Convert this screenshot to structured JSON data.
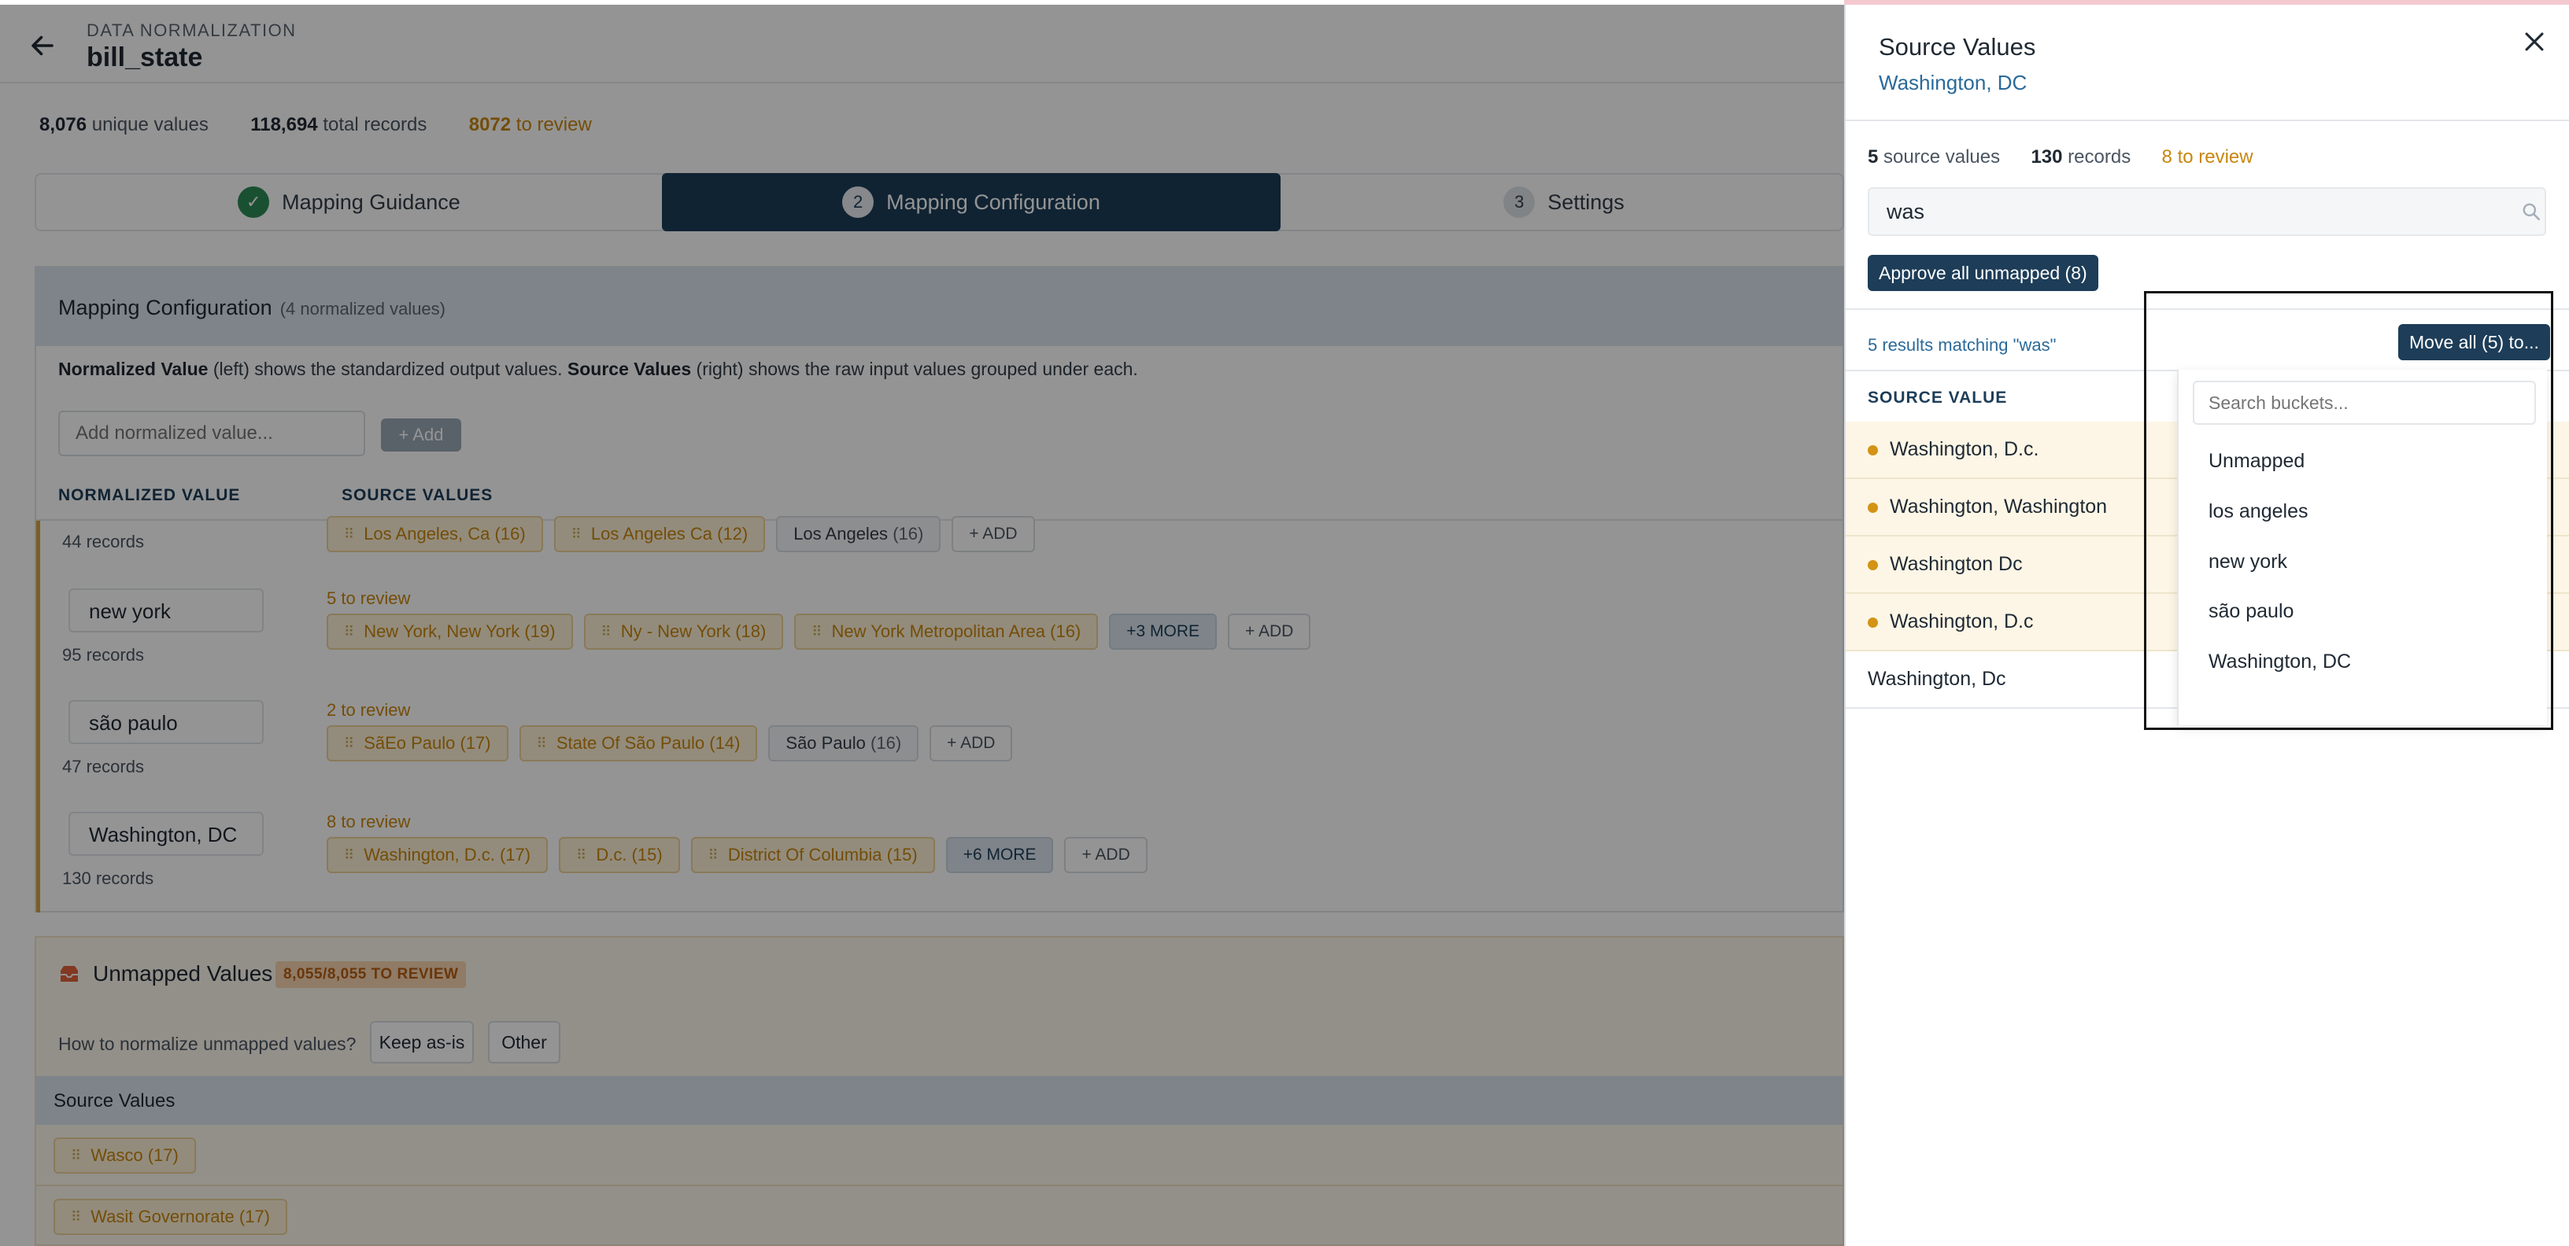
{
  "header": {
    "breadcrumb": "DATA NORMALIZATION",
    "title": "bill_state"
  },
  "stats": {
    "unique_values": "8,076",
    "unique_label": "unique values",
    "total_records": "118,694",
    "total_label": "total records",
    "to_review": "8072",
    "to_review_label": "to review"
  },
  "steps": [
    {
      "number": "✓",
      "label": "Mapping Guidance"
    },
    {
      "number": "2",
      "label": "Mapping Configuration"
    },
    {
      "number": "3",
      "label": "Settings"
    }
  ],
  "mapping_config": {
    "title": "Mapping Configuration",
    "count": "(4 normalized values)",
    "desc_nv": "Normalized Value",
    "desc_1": " (left) shows the standardized output values. ",
    "desc_sv": "Source Values",
    "desc_2": " (right) shows the raw input values grouped under each.",
    "add_placeholder": "Add normalized value...",
    "add_label": "+  Add",
    "col_normalized": "NORMALIZED VALUE",
    "col_source": "SOURCE VALUES",
    "rows": [
      {
        "bucket": "",
        "records": "44 records",
        "review": "",
        "chips": [
          {
            "kind": "pending",
            "label": "Los Angeles, Ca (16)"
          },
          {
            "kind": "pending",
            "label": "Los Angeles Ca (12)"
          },
          {
            "kind": "mapped",
            "label": "Los Angeles",
            "count": "(16)"
          },
          {
            "kind": "add",
            "label": "+ ADD"
          }
        ]
      },
      {
        "bucket": "new york",
        "records": "95 records",
        "review": "5 to review",
        "chips": [
          {
            "kind": "pending",
            "label": "New York, New York (19)"
          },
          {
            "kind": "pending",
            "label": "Ny - New York (18)"
          },
          {
            "kind": "pending",
            "label": "New York Metropolitan Area (16)"
          },
          {
            "kind": "more",
            "label": "+3 MORE"
          },
          {
            "kind": "add",
            "label": "+ ADD"
          }
        ]
      },
      {
        "bucket": "são paulo",
        "records": "47 records",
        "review": "2 to review",
        "chips": [
          {
            "kind": "pending",
            "label": "SãEo Paulo (17)"
          },
          {
            "kind": "pending",
            "label": "State Of São Paulo (14)"
          },
          {
            "kind": "mapped",
            "label": "São Paulo",
            "count": "(16)"
          },
          {
            "kind": "add",
            "label": "+ ADD"
          }
        ]
      },
      {
        "bucket": "Washington, DC",
        "records": "130 records",
        "review": "8 to review",
        "chips": [
          {
            "kind": "pending",
            "label": "Washington, D.c. (17)"
          },
          {
            "kind": "pending",
            "label": "D.c. (15)"
          },
          {
            "kind": "pending",
            "label": "District Of Columbia (15)"
          },
          {
            "kind": "more",
            "label": "+6 MORE"
          },
          {
            "kind": "add",
            "label": "+ ADD"
          }
        ]
      }
    ]
  },
  "unmapped": {
    "title": "Unmapped Values",
    "badge": "8,055/8,055 TO REVIEW",
    "how_label": "How to normalize unmapped values?",
    "keep_label": "Keep as-is",
    "other_label": "Other",
    "source_head": "Source Values",
    "rows": [
      "Wasco (17)",
      "Wasit Governorate (17)"
    ]
  },
  "panel": {
    "title": "Source Values",
    "subtitle": "Washington, DC",
    "source_count": "5",
    "source_label": "source values",
    "records_count": "130",
    "records_label": "records",
    "review_count": "8",
    "review_label": "to review",
    "search_value": "was",
    "approve_label": "Approve all unmapped (8)",
    "results_label": "5 results matching \"was\"",
    "move_all_label": "Move all (5) to...",
    "col_source": "SOURCE VALUE",
    "items": [
      {
        "label": "Washington, D.c.",
        "pending": true
      },
      {
        "label": "Washington, Washington",
        "pending": true
      },
      {
        "label": "Washington Dc",
        "pending": true
      },
      {
        "label": "Washington, D.c",
        "pending": true
      },
      {
        "label": "Washington, Dc",
        "pending": false
      }
    ]
  },
  "dropdown": {
    "search_placeholder": "Search buckets...",
    "options": [
      "Unmapped",
      "los angeles",
      "new york",
      "são paulo",
      "Washington, DC"
    ]
  },
  "colors": {
    "primary": "#1d3d58",
    "review": "#c9860e",
    "link": "#2a6a9a",
    "success": "#2e8b57"
  }
}
